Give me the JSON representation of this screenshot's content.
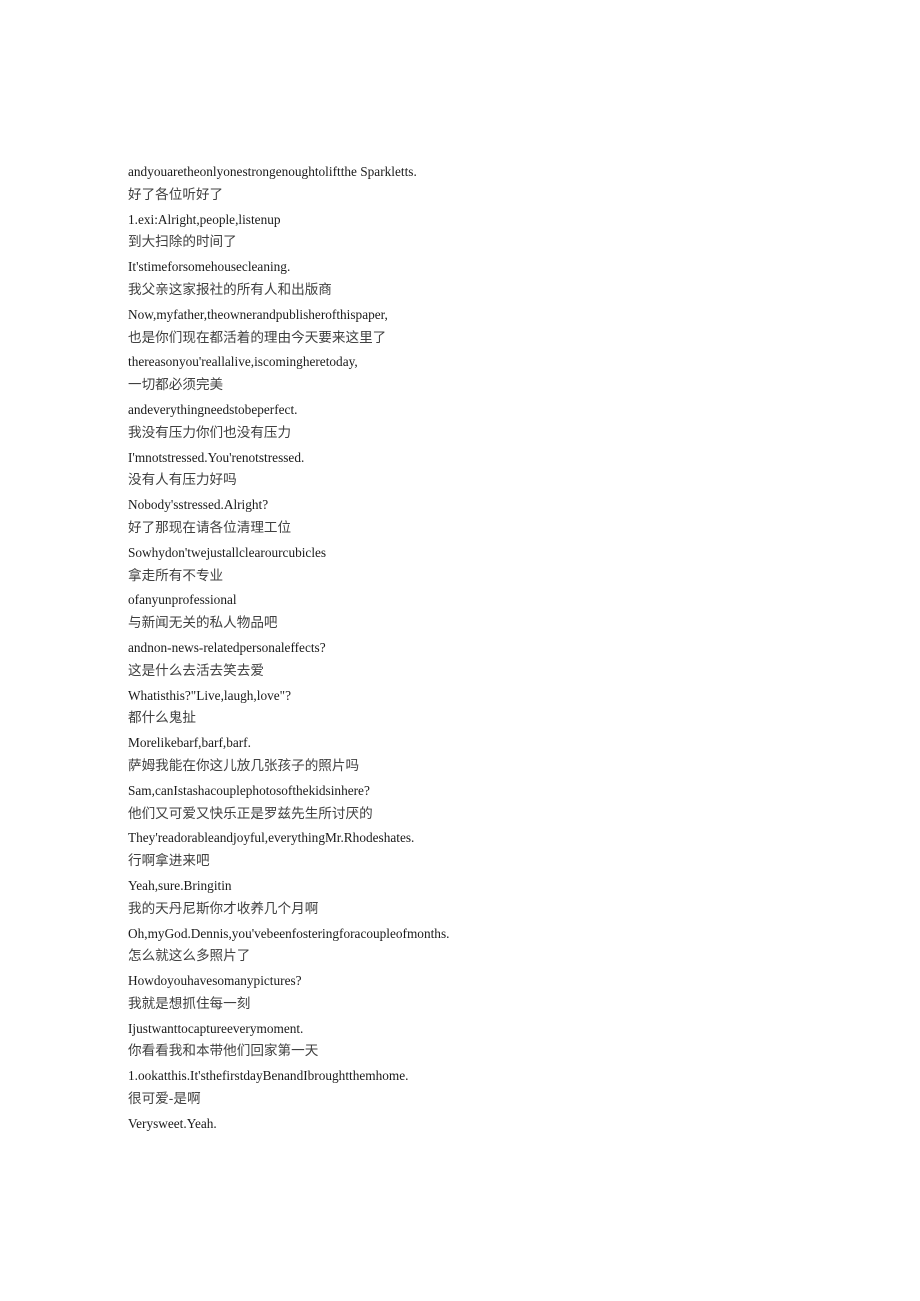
{
  "document": {
    "kind": "bilingual-subtitle-transcript",
    "page_background": "#ffffff",
    "english_text_color": "#1a1a1a",
    "chinese_text_color": "#404040",
    "lines": [
      {
        "lang": "en",
        "text": "andyouaretheonlyonestrongenoughtoliftthe Sparkletts."
      },
      {
        "lang": "zh",
        "text": "好了各位听好了"
      },
      {
        "lang": "en",
        "text": "1.exi:Alright,people,listenup"
      },
      {
        "lang": "zh",
        "text": "到大扫除的时间了"
      },
      {
        "lang": "en",
        "text": "It'stimeforsomehousecleaning."
      },
      {
        "lang": "zh",
        "text": "我父亲这家报社的所有人和出版商"
      },
      {
        "lang": "en",
        "text": "Now,myfather,theownerandpublisherofthispaper,"
      },
      {
        "lang": "zh",
        "text": "也是你们现在都活着的理由今天要来这里了"
      },
      {
        "lang": "en",
        "text": "thereasonyou'reallalive,iscomingheretoday,"
      },
      {
        "lang": "zh",
        "text": "一切都必须完美"
      },
      {
        "lang": "en",
        "text": "andeverythingneedstobeperfect."
      },
      {
        "lang": "zh",
        "text": "我没有压力你们也没有压力"
      },
      {
        "lang": "en",
        "text": "I'mnotstressed.You'renotstressed."
      },
      {
        "lang": "zh",
        "text": "没有人有压力好吗"
      },
      {
        "lang": "en",
        "text": "Nobody'sstressed.Alright?"
      },
      {
        "lang": "zh",
        "text": "好了那现在请各位清理工位"
      },
      {
        "lang": "en",
        "text": "Sowhydon'twejustallclearourcubicles"
      },
      {
        "lang": "zh",
        "text": "拿走所有不专业"
      },
      {
        "lang": "en",
        "text": "ofanyunprofessional"
      },
      {
        "lang": "zh",
        "text": "与新闻无关的私人物品吧"
      },
      {
        "lang": "en",
        "text": "andnon-news-relatedpersonaleffects?"
      },
      {
        "lang": "zh",
        "text": "这是什么去活去笑去爱"
      },
      {
        "lang": "en",
        "text": "Whatisthis?\"Live,laugh,love\"?"
      },
      {
        "lang": "zh",
        "text": "都什么鬼扯"
      },
      {
        "lang": "en",
        "text": "Morelikebarf,barf,barf."
      },
      {
        "lang": "zh",
        "text": "萨姆我能在你这儿放几张孩子的照片吗"
      },
      {
        "lang": "en",
        "text": "Sam,canIstashacouplephotosofthekidsinhere?"
      },
      {
        "lang": "zh",
        "text": "他们又可爱又快乐正是罗兹先生所讨厌的"
      },
      {
        "lang": "en",
        "text": "They'readorableandjoyful,everythingMr.Rhodeshates."
      },
      {
        "lang": "zh",
        "text": "行啊拿进来吧"
      },
      {
        "lang": "en",
        "text": "Yeah,sure.Bringitin"
      },
      {
        "lang": "zh",
        "text": "我的天丹尼斯你才收养几个月啊"
      },
      {
        "lang": "en",
        "text": "Oh,myGod.Dennis,you'vebeenfosteringforacoupleofmonths."
      },
      {
        "lang": "zh",
        "text": "怎么就这么多照片了"
      },
      {
        "lang": "en",
        "text": "Howdoyouhavesomanypictures?"
      },
      {
        "lang": "zh",
        "text": "我就是想抓住每一刻"
      },
      {
        "lang": "en",
        "text": "Ijustwanttocaptureeverymoment."
      },
      {
        "lang": "zh",
        "text": "你看看我和本带他们回家第一天"
      },
      {
        "lang": "en",
        "text": "1.ookatthis.It'sthefirstdayBenandIbroughtthemhome."
      },
      {
        "lang": "zh",
        "text": "很可爱-是啊"
      },
      {
        "lang": "en",
        "text": "Verysweet.Yeah."
      }
    ]
  }
}
